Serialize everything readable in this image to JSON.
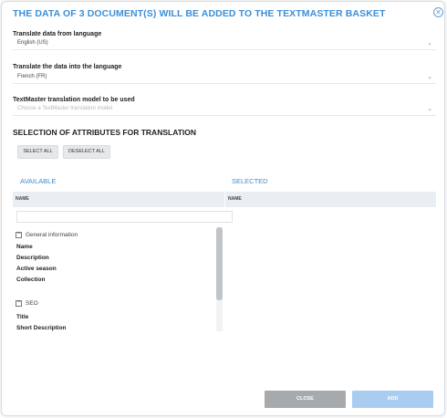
{
  "dialog": {
    "title": "THE DATA OF 3 DOCUMENT(S) WILL BE ADDED TO THE TEXTMASTER BASKET",
    "close_symbol": "✕"
  },
  "form": {
    "source_language": {
      "label": "Translate data from language",
      "value": "English (US)"
    },
    "target_language": {
      "label": "Translate the data into the language",
      "value": "French (FR)"
    },
    "translation_model": {
      "label": "TextMaster translation model to be used",
      "placeholder": "Choose a TextMaster translation model"
    }
  },
  "attributes": {
    "section_title": "SELECTION OF ATTRIBUTES FOR TRANSLATION",
    "select_all_label": "SELECT ALL",
    "deselect_all_label": "DESELECT ALL",
    "available": {
      "title": "AVAILABLE",
      "column_header": "NAME",
      "groups": [
        {
          "label": "General information",
          "toggle": "−",
          "items": [
            "Name",
            "Description",
            "Active season",
            "Collection"
          ]
        },
        {
          "label": "SEO",
          "toggle": "−",
          "items": [
            "Title",
            "Short Description"
          ]
        }
      ]
    },
    "selected": {
      "title": "SELECTED",
      "column_header": "NAME"
    }
  },
  "footer": {
    "close_label": "CLOSE",
    "add_label": "ADD",
    "colors": {
      "close": "#a7aaad",
      "add": "#a9cdf1"
    }
  },
  "colors": {
    "accent": "#3c8fd6"
  }
}
